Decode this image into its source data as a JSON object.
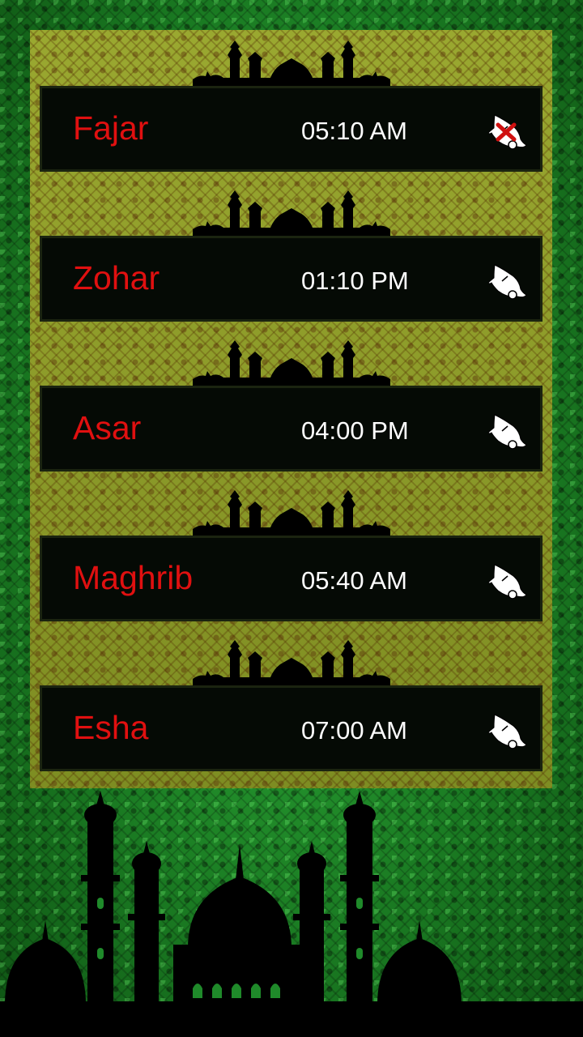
{
  "prayers": [
    {
      "name": "Fajar",
      "time": "05:10 AM",
      "alarm": "off"
    },
    {
      "name": "Zohar",
      "time": "01:10 PM",
      "alarm": "on"
    },
    {
      "name": "Asar",
      "time": "04:00 PM",
      "alarm": "on"
    },
    {
      "name": "Maghrib",
      "time": "05:40 AM",
      "alarm": "on"
    },
    {
      "name": "Esha",
      "time": "07:00 AM",
      "alarm": "on"
    }
  ],
  "icons": {
    "alarm_on": "bell-icon",
    "alarm_off": "bell-muted-icon"
  },
  "colors": {
    "prayer_name": "#e01010",
    "prayer_time": "#ffffff",
    "row_background": "#050a05",
    "background": "#1f8a2a",
    "panel": "#8c9a2c"
  }
}
